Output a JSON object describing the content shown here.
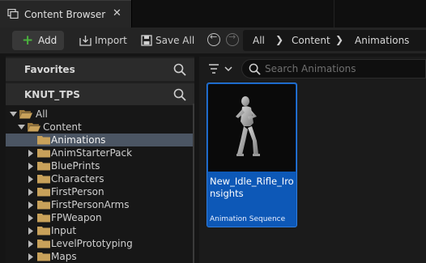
{
  "tab": {
    "title": "Content Browser",
    "close": "✕"
  },
  "toolbar": {
    "add_label": "Add",
    "import_label": "Import",
    "save_all_label": "Save All"
  },
  "breadcrumb": [
    "All",
    "Content",
    "Animations"
  ],
  "sidebar": {
    "favorites_title": "Favorites",
    "project_title": "KNUT_TPS",
    "tree": [
      {
        "label": "All",
        "level": 0,
        "expanded": true,
        "selected": false
      },
      {
        "label": "Content",
        "level": 1,
        "expanded": true,
        "selected": false
      },
      {
        "label": "Animations",
        "level": 2,
        "expanded": false,
        "selected": true
      },
      {
        "label": "AnimStarterPack",
        "level": 2,
        "expanded": false,
        "selected": false
      },
      {
        "label": "BluePrints",
        "level": 2,
        "expanded": false,
        "selected": false
      },
      {
        "label": "Characters",
        "level": 2,
        "expanded": false,
        "selected": false
      },
      {
        "label": "FirstPerson",
        "level": 2,
        "expanded": false,
        "selected": false
      },
      {
        "label": "FirstPersonArms",
        "level": 2,
        "expanded": false,
        "selected": false
      },
      {
        "label": "FPWeapon",
        "level": 2,
        "expanded": false,
        "selected": false
      },
      {
        "label": "Input",
        "level": 2,
        "expanded": false,
        "selected": false
      },
      {
        "label": "LevelPrototyping",
        "level": 2,
        "expanded": false,
        "selected": false
      },
      {
        "label": "Maps",
        "level": 2,
        "expanded": false,
        "selected": false
      }
    ]
  },
  "content": {
    "search_placeholder": "Search Animations",
    "assets": [
      {
        "name": "New_Idle_Rifle_Ironsights",
        "type": "Animation Sequence"
      }
    ]
  },
  "colors": {
    "accent": "#0d58b7",
    "add_green": "#4ab13e",
    "folder": "#c8a15a",
    "selected_row": "#4b5563"
  }
}
